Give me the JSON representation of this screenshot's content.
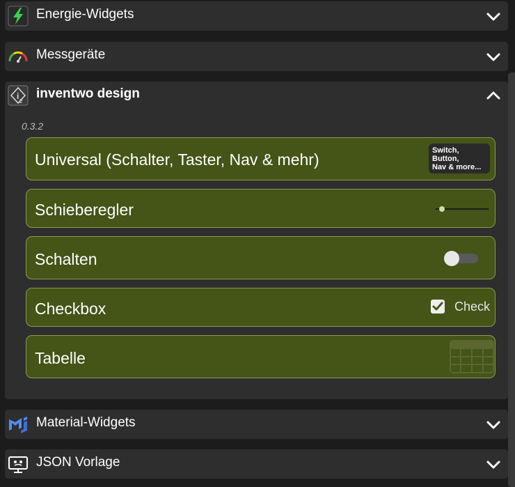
{
  "categories_top": [
    {
      "title": "Energie-Widgets",
      "icon": "lightning-icon"
    },
    {
      "title": "Messgeräte",
      "icon": "gauge-icon"
    }
  ],
  "panel": {
    "title": "inventwo design",
    "icon": "inventwo-logo-icon",
    "version": "0.3.2",
    "widgets": [
      {
        "label": "Universal (Schalter, Taster, Nav & mehr)",
        "preview_lines": [
          "Switch,",
          "Button,",
          "Nav & more..."
        ]
      },
      {
        "label": "Schieberegler",
        "preview": "slider-preview"
      },
      {
        "label": "Schalten",
        "preview": "toggle-preview"
      },
      {
        "label": "Checkbox",
        "preview_text": "Check"
      },
      {
        "label": "Tabelle",
        "preview": "table-preview"
      }
    ]
  },
  "categories_bottom": [
    {
      "title": "Material-Widgets",
      "icon": "material-widgets-icon"
    },
    {
      "title": "JSON Vorlage",
      "icon": "json-template-icon"
    }
  ],
  "colors": {
    "background": "#1c1c1c",
    "category": "#2e2e2e",
    "widget": "#455417",
    "widget_border": "#8b9a4e",
    "accent_green": "#4caf50"
  }
}
